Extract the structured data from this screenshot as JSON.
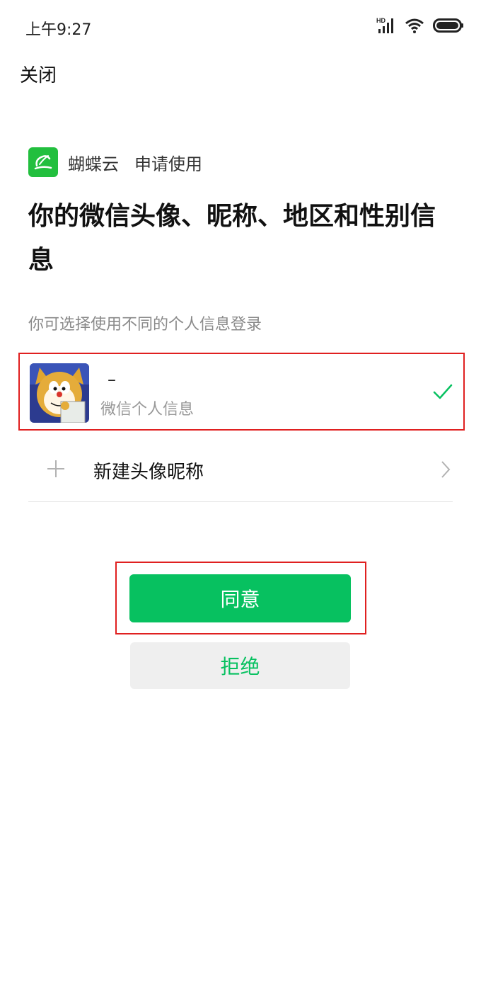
{
  "status_bar": {
    "time": "上午9:27",
    "network_label": "HD",
    "icons": [
      "signal-icon",
      "wifi-icon",
      "battery-icon"
    ]
  },
  "header": {
    "close_label": "关闭"
  },
  "app": {
    "logo_icon": "butterfly-cloud-logo",
    "name": "蝴蝶云",
    "request_text": "申请使用"
  },
  "title": "你的微信头像、昵称、地区和性别信息",
  "subtitle": "你可选择使用不同的个人信息登录",
  "profile_option": {
    "name": "–",
    "description": "微信个人信息",
    "selected": true
  },
  "new_profile_option": {
    "label": "新建头像昵称"
  },
  "actions": {
    "agree_label": "同意",
    "reject_label": "拒绝"
  },
  "colors": {
    "accent_green": "#07c160",
    "highlight_red": "#e02020",
    "reject_bg": "#efefef"
  }
}
